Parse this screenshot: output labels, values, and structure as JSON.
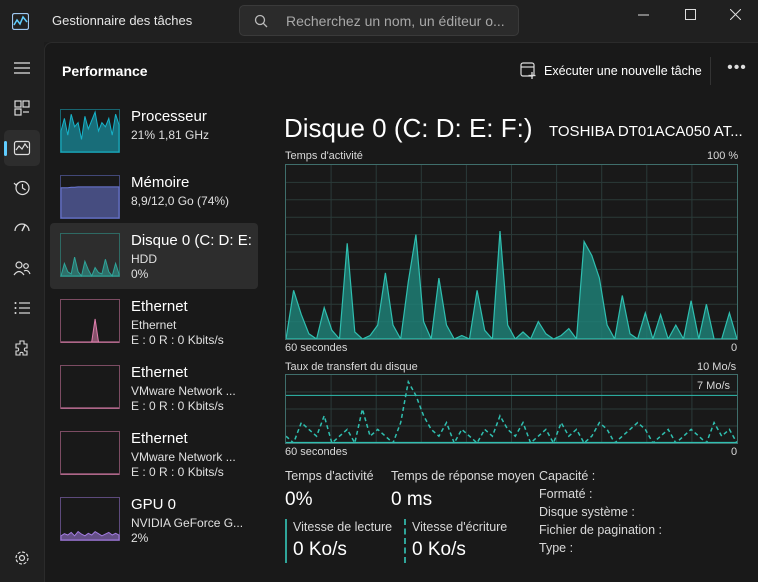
{
  "window": {
    "title": "Gestionnaire des tâches",
    "search_placeholder": "Recherchez un nom, un éditeur o..."
  },
  "nav": {
    "items": [
      {
        "name": "nav-hamburger",
        "icon": "hamburger-icon"
      },
      {
        "name": "nav-processes",
        "icon": "processes-icon"
      },
      {
        "name": "nav-performance",
        "icon": "performance-icon",
        "active": true
      },
      {
        "name": "nav-app-history",
        "icon": "history-icon"
      },
      {
        "name": "nav-startup",
        "icon": "startup-icon"
      },
      {
        "name": "nav-users",
        "icon": "users-icon"
      },
      {
        "name": "nav-details",
        "icon": "details-icon"
      },
      {
        "name": "nav-services",
        "icon": "services-icon"
      },
      {
        "name": "nav-settings",
        "icon": "gear-icon"
      }
    ]
  },
  "header": {
    "title": "Performance",
    "run_task": "Exécuter une nouvelle tâche"
  },
  "devices": [
    {
      "name": "Processeur",
      "l1": "21%  1,81 GHz",
      "l2": "",
      "color": "#17b2c8"
    },
    {
      "name": "Mémoire",
      "l1": "8,9/12,0 Go (74%)",
      "l2": "",
      "color": "#6b78d6"
    },
    {
      "name": "Disque 0 (C: D: E: F:)",
      "l1": "HDD",
      "l2": "0%",
      "color": "#2fa59a",
      "selected": true
    },
    {
      "name": "Ethernet",
      "l1": "Ethernet",
      "l2": "E : 0 R : 0 Kbits/s",
      "color": "#e07fae"
    },
    {
      "name": "Ethernet",
      "l1": "VMware Network ...",
      "l2": "E : 0 R : 0 Kbits/s",
      "color": "#e07fae"
    },
    {
      "name": "Ethernet",
      "l1": "VMware Network ...",
      "l2": "E : 0 R : 0 Kbits/s",
      "color": "#e07fae"
    },
    {
      "name": "GPU 0",
      "l1": "NVIDIA GeForce G...",
      "l2": "2%",
      "color": "#a27be0"
    }
  ],
  "detail": {
    "title": "Disque 0 (C: D: E: F:)",
    "model": "TOSHIBA DT01ACA050 AT...",
    "activity_graph": {
      "label": "Temps d'activité",
      "max_label": "100 %",
      "time_label": "60 secondes",
      "min_label": "0",
      "values": [
        0,
        28,
        14,
        3,
        0,
        18,
        5,
        0,
        55,
        4,
        0,
        2,
        8,
        38,
        8,
        0,
        33,
        60,
        10,
        0,
        35,
        8,
        0,
        2,
        0,
        28,
        5,
        0,
        62,
        8,
        0,
        4,
        0,
        10,
        3,
        0,
        2,
        6,
        0,
        56,
        48,
        35,
        8,
        0,
        25,
        3,
        0,
        15,
        0,
        14,
        0,
        8,
        0,
        22,
        0,
        20,
        0,
        0,
        15,
        0
      ]
    },
    "transfer_graph": {
      "label": "Taux de transfert du disque",
      "max_label": "10 Mo/s",
      "line_label": "7 Mo/s",
      "time_label": "60 secondes",
      "min_label": "0",
      "read_values": [
        1,
        0,
        3,
        2,
        1,
        4,
        0,
        1,
        2,
        0,
        5,
        1,
        2,
        1,
        0,
        3,
        9,
        7,
        4,
        2,
        1,
        3,
        0,
        2,
        1,
        0,
        2,
        1,
        4,
        2,
        1,
        3,
        0,
        1,
        2,
        0,
        3,
        1,
        2,
        0,
        1,
        3,
        2,
        0,
        1,
        2,
        3,
        2,
        0,
        1,
        2,
        0,
        1,
        2,
        1,
        0,
        3,
        1,
        2,
        0
      ],
      "write_values": [
        0,
        0,
        0,
        0,
        0,
        0,
        0,
        0,
        0,
        0,
        0,
        0,
        0,
        0,
        0,
        0,
        0,
        0,
        0,
        0,
        0,
        0,
        0,
        0,
        0,
        0,
        0,
        0,
        0,
        0,
        0,
        0,
        0,
        0,
        0,
        0,
        0,
        0,
        0,
        0,
        0,
        0,
        0,
        0,
        0,
        0,
        0,
        0,
        0,
        0,
        0,
        0,
        0,
        0,
        0,
        0,
        0,
        0,
        0,
        0
      ]
    },
    "stats": {
      "activity_label": "Temps d'activité",
      "activity_value": "0%",
      "response_label": "Temps de réponse moyen",
      "response_value": "0 ms",
      "read_label": "Vitesse de lecture",
      "read_value": "0 Ko/s",
      "write_label": "Vitesse d'écriture",
      "write_value": "0 Ko/s"
    },
    "properties": [
      "Capacité :",
      "Formaté :",
      "Disque système :",
      "Fichier de pagination :",
      "Type :"
    ]
  }
}
